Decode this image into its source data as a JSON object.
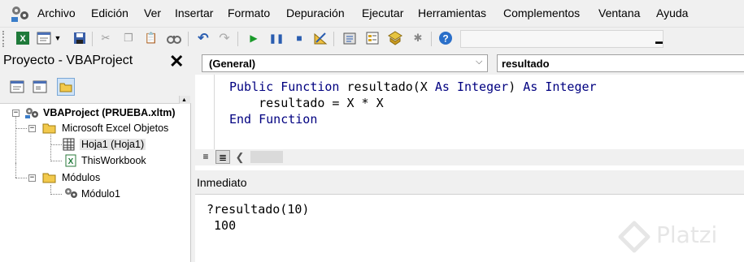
{
  "menu": {
    "items": [
      "Archivo",
      "Edición",
      "Ver",
      "Insertar",
      "Formato",
      "Depuración",
      "Ejecutar",
      "Herramientas",
      "Complementos",
      "Ventana",
      "Ayuda"
    ]
  },
  "toolbar": {
    "icons": [
      "excel-icon",
      "insert-module-icon",
      "dropdown-arrow-icon",
      "save-icon",
      "cut-icon",
      "copy-icon",
      "paste-icon",
      "find-icon",
      "undo-icon",
      "redo-icon",
      "run-icon",
      "break-icon",
      "reset-icon",
      "design-mode-icon",
      "project-explorer-icon",
      "properties-icon",
      "object-browser-icon",
      "toolbox-icon",
      "help-icon"
    ],
    "location": ""
  },
  "project": {
    "title": "Proyecto - VBAProject",
    "close": "✕",
    "tree": {
      "root": "VBAProject (PRUEBA.xltm)",
      "folder_excel": "Microsoft Excel Objetos",
      "hoja1": "Hoja1 (Hoja1)",
      "thisworkbook": "ThisWorkbook",
      "folder_modules": "Módulos",
      "module1": "Módulo1"
    }
  },
  "code": {
    "object_combo": "(General)",
    "procedure_combo": "resultado",
    "lines": {
      "l1_kw1": "Public Function",
      "l1_rest": " resultado(X ",
      "l1_kw2": "As Integer",
      "l1_mid": ") ",
      "l1_kw3": "As Integer",
      "l2": "    resultado = X * X",
      "l3_kw": "End Function"
    }
  },
  "immediate": {
    "title": "Inmediato",
    "lines": [
      "?resultado(10)",
      " 100"
    ]
  },
  "watermark": {
    "text": "Platzi"
  },
  "colors": {
    "keyword": "#000080",
    "background": "#f0f0f0",
    "selection": "#e5e5e5"
  }
}
